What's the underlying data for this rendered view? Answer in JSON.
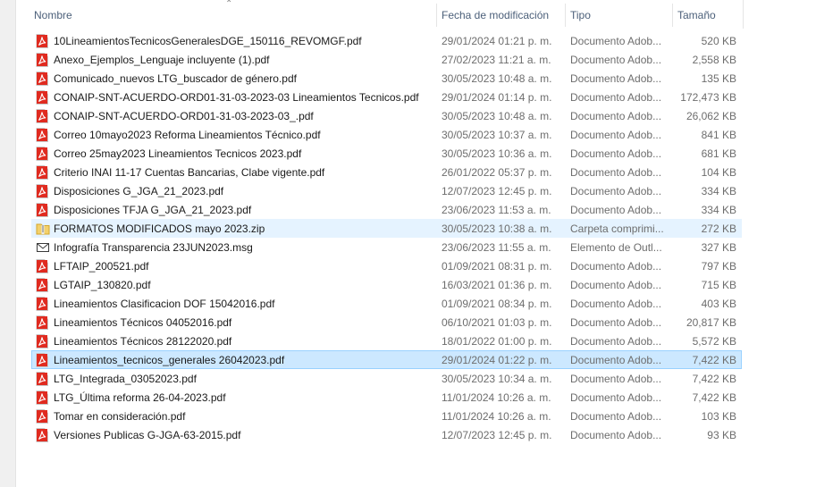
{
  "columns": {
    "name": "Nombre",
    "date": "Fecha de modificación",
    "type": "Tipo",
    "size": "Tamaño"
  },
  "files": [
    {
      "name": "10LineamientosTecnicosGeneralesDGE_150116_REVOMGF.pdf",
      "date": "29/01/2024 01:21 p. m.",
      "type": "Documento Adob...",
      "size": "520 KB",
      "icon": "pdf-icon",
      "state": ""
    },
    {
      "name": "Anexo_Ejemplos_Lenguaje incluyente (1).pdf",
      "date": "27/02/2023 11:21 a. m.",
      "type": "Documento Adob...",
      "size": "2,558 KB",
      "icon": "pdf-icon",
      "state": ""
    },
    {
      "name": "Comunicado_nuevos LTG_buscador de género.pdf",
      "date": "30/05/2023 10:48 a. m.",
      "type": "Documento Adob...",
      "size": "135 KB",
      "icon": "pdf-icon",
      "state": ""
    },
    {
      "name": "CONAIP-SNT-ACUERDO-ORD01-31-03-2023-03 Lineamientos Tecnicos.pdf",
      "date": "29/01/2024 01:14 p. m.",
      "type": "Documento Adob...",
      "size": "172,473 KB",
      "icon": "pdf-icon",
      "state": ""
    },
    {
      "name": "CONAIP-SNT-ACUERDO-ORD01-31-03-2023-03_.pdf",
      "date": "30/05/2023 10:48 a. m.",
      "type": "Documento Adob...",
      "size": "26,062 KB",
      "icon": "pdf-icon",
      "state": ""
    },
    {
      "name": "Correo 10mayo2023 Reforma Lineamientos Técnico.pdf",
      "date": "30/05/2023 10:37 a. m.",
      "type": "Documento Adob...",
      "size": "841 KB",
      "icon": "pdf-icon",
      "state": ""
    },
    {
      "name": "Correo 25may2023 Lineamientos Tecnicos 2023.pdf",
      "date": "30/05/2023 10:36 a. m.",
      "type": "Documento Adob...",
      "size": "681 KB",
      "icon": "pdf-icon",
      "state": ""
    },
    {
      "name": "Criterio INAI 11-17 Cuentas Bancarias, Clabe vigente.pdf",
      "date": "26/01/2022 05:37 p. m.",
      "type": "Documento Adob...",
      "size": "104 KB",
      "icon": "pdf-icon",
      "state": ""
    },
    {
      "name": "Disposiciones G_JGA_21_2023.pdf",
      "date": "12/07/2023 12:45 p. m.",
      "type": "Documento Adob...",
      "size": "334 KB",
      "icon": "pdf-icon",
      "state": ""
    },
    {
      "name": "Disposiciones TFJA G_JGA_21_2023.pdf",
      "date": "23/06/2023 11:53 a. m.",
      "type": "Documento Adob...",
      "size": "334 KB",
      "icon": "pdf-icon",
      "state": ""
    },
    {
      "name": "FORMATOS MODIFICADOS mayo 2023.zip",
      "date": "30/05/2023 10:38 a. m.",
      "type": "Carpeta comprimi...",
      "size": "272 KB",
      "icon": "zip-folder-icon",
      "state": "hover"
    },
    {
      "name": "Infografía Transparencia 23JUN2023.msg",
      "date": "23/06/2023 11:55 a. m.",
      "type": "Elemento de Outl...",
      "size": "327 KB",
      "icon": "mail-icon",
      "state": ""
    },
    {
      "name": "LFTAIP_200521.pdf",
      "date": "01/09/2021 08:31 p. m.",
      "type": "Documento Adob...",
      "size": "797 KB",
      "icon": "pdf-icon",
      "state": ""
    },
    {
      "name": "LGTAIP_130820.pdf",
      "date": "16/03/2021 01:36 p. m.",
      "type": "Documento Adob...",
      "size": "715 KB",
      "icon": "pdf-icon",
      "state": ""
    },
    {
      "name": "Lineamientos Clasificacion DOF 15042016.pdf",
      "date": "01/09/2021 08:34 p. m.",
      "type": "Documento Adob...",
      "size": "403 KB",
      "icon": "pdf-icon",
      "state": ""
    },
    {
      "name": "Lineamientos Técnicos  04052016.pdf",
      "date": "06/10/2021 01:03 p. m.",
      "type": "Documento Adob...",
      "size": "20,817 KB",
      "icon": "pdf-icon",
      "state": ""
    },
    {
      "name": "Lineamientos Técnicos  28122020.pdf",
      "date": "18/01/2022 01:00 p. m.",
      "type": "Documento Adob...",
      "size": "5,572 KB",
      "icon": "pdf-icon",
      "state": ""
    },
    {
      "name": "Lineamientos_tecnicos_generales 26042023.pdf",
      "date": "29/01/2024 01:22 p. m.",
      "type": "Documento Adob...",
      "size": "7,422 KB",
      "icon": "pdf-icon",
      "state": "selected"
    },
    {
      "name": "LTG_Integrada_03052023.pdf",
      "date": "30/05/2023 10:34 a. m.",
      "type": "Documento Adob...",
      "size": "7,422 KB",
      "icon": "pdf-icon",
      "state": ""
    },
    {
      "name": "LTG_Última reforma 26-04-2023.pdf",
      "date": "11/01/2024 10:26 a. m.",
      "type": "Documento Adob...",
      "size": "7,422 KB",
      "icon": "pdf-icon",
      "state": ""
    },
    {
      "name": "Tomar en consideración.pdf",
      "date": "11/01/2024 10:26 a. m.",
      "type": "Documento Adob...",
      "size": "103 KB",
      "icon": "pdf-icon",
      "state": ""
    },
    {
      "name": "Versiones Publicas G-JGA-63-2015.pdf",
      "date": "12/07/2023 12:45 p. m.",
      "type": "Documento Adob...",
      "size": "93 KB",
      "icon": "pdf-icon",
      "state": ""
    }
  ]
}
